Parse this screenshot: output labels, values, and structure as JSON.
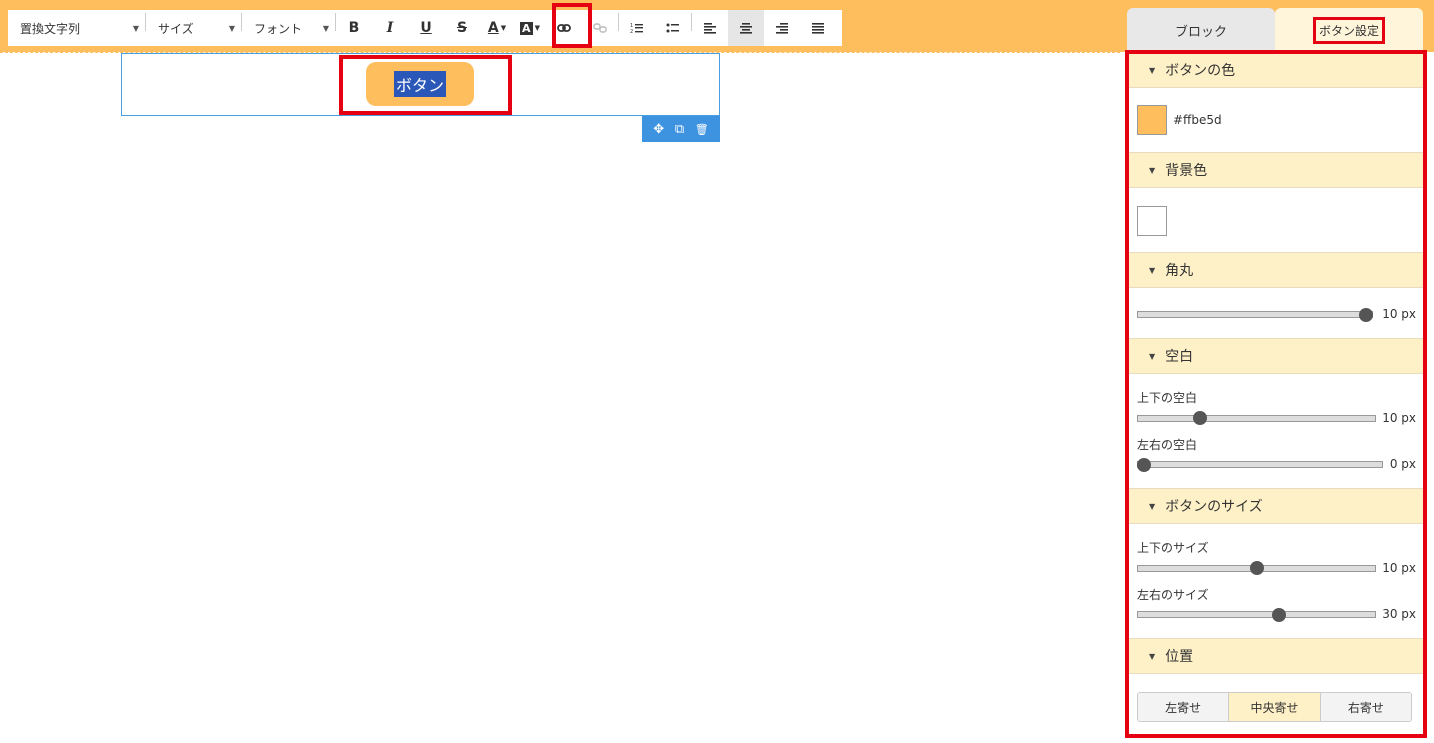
{
  "colors": {
    "accent": "#ffbe5d",
    "selection": "#2a57b8",
    "block_border": "#4a9ee0",
    "highlight": "#e50012"
  },
  "toolbar": {
    "replace_text": "置換文字列",
    "size": "サイズ",
    "font": "フォント",
    "bold": "B",
    "italic": "I",
    "underline": "U",
    "strike": "S",
    "font_color": "A",
    "bg_color": "A"
  },
  "canvas": {
    "button_label": "ボタン",
    "tools": {
      "move": "✥",
      "copy": "⧉",
      "delete": "🗑"
    }
  },
  "tabs": {
    "block": "ブロック",
    "button_settings": "ボタン設定"
  },
  "panel": {
    "button_color": {
      "title": "ボタンの色",
      "value": "#ffbe5d",
      "label": "#ffbe5d"
    },
    "background": {
      "title": "背景色",
      "value": "#ffffff"
    },
    "radius": {
      "title": "角丸",
      "value": 10,
      "max": 10,
      "value_text": "10 px"
    },
    "spacing": {
      "title": "空白",
      "vertical_label": "上下の空白",
      "vertical": 10,
      "vertical_max": 40,
      "vertical_text": "10 px",
      "horizontal_label": "左右の空白",
      "horizontal": 0,
      "horizontal_max": 40,
      "horizontal_text": "0 px"
    },
    "button_size": {
      "title": "ボタンのサイズ",
      "vertical_label": "上下のサイズ",
      "vertical": 10,
      "vertical_max": 20,
      "vertical_text": "10 px",
      "horizontal_label": "左右のサイズ",
      "horizontal": 30,
      "horizontal_max": 50,
      "horizontal_text": "30 px"
    },
    "position": {
      "title": "位置",
      "options": [
        "左寄せ",
        "中央寄せ",
        "右寄せ"
      ],
      "selected": "中央寄せ"
    }
  }
}
